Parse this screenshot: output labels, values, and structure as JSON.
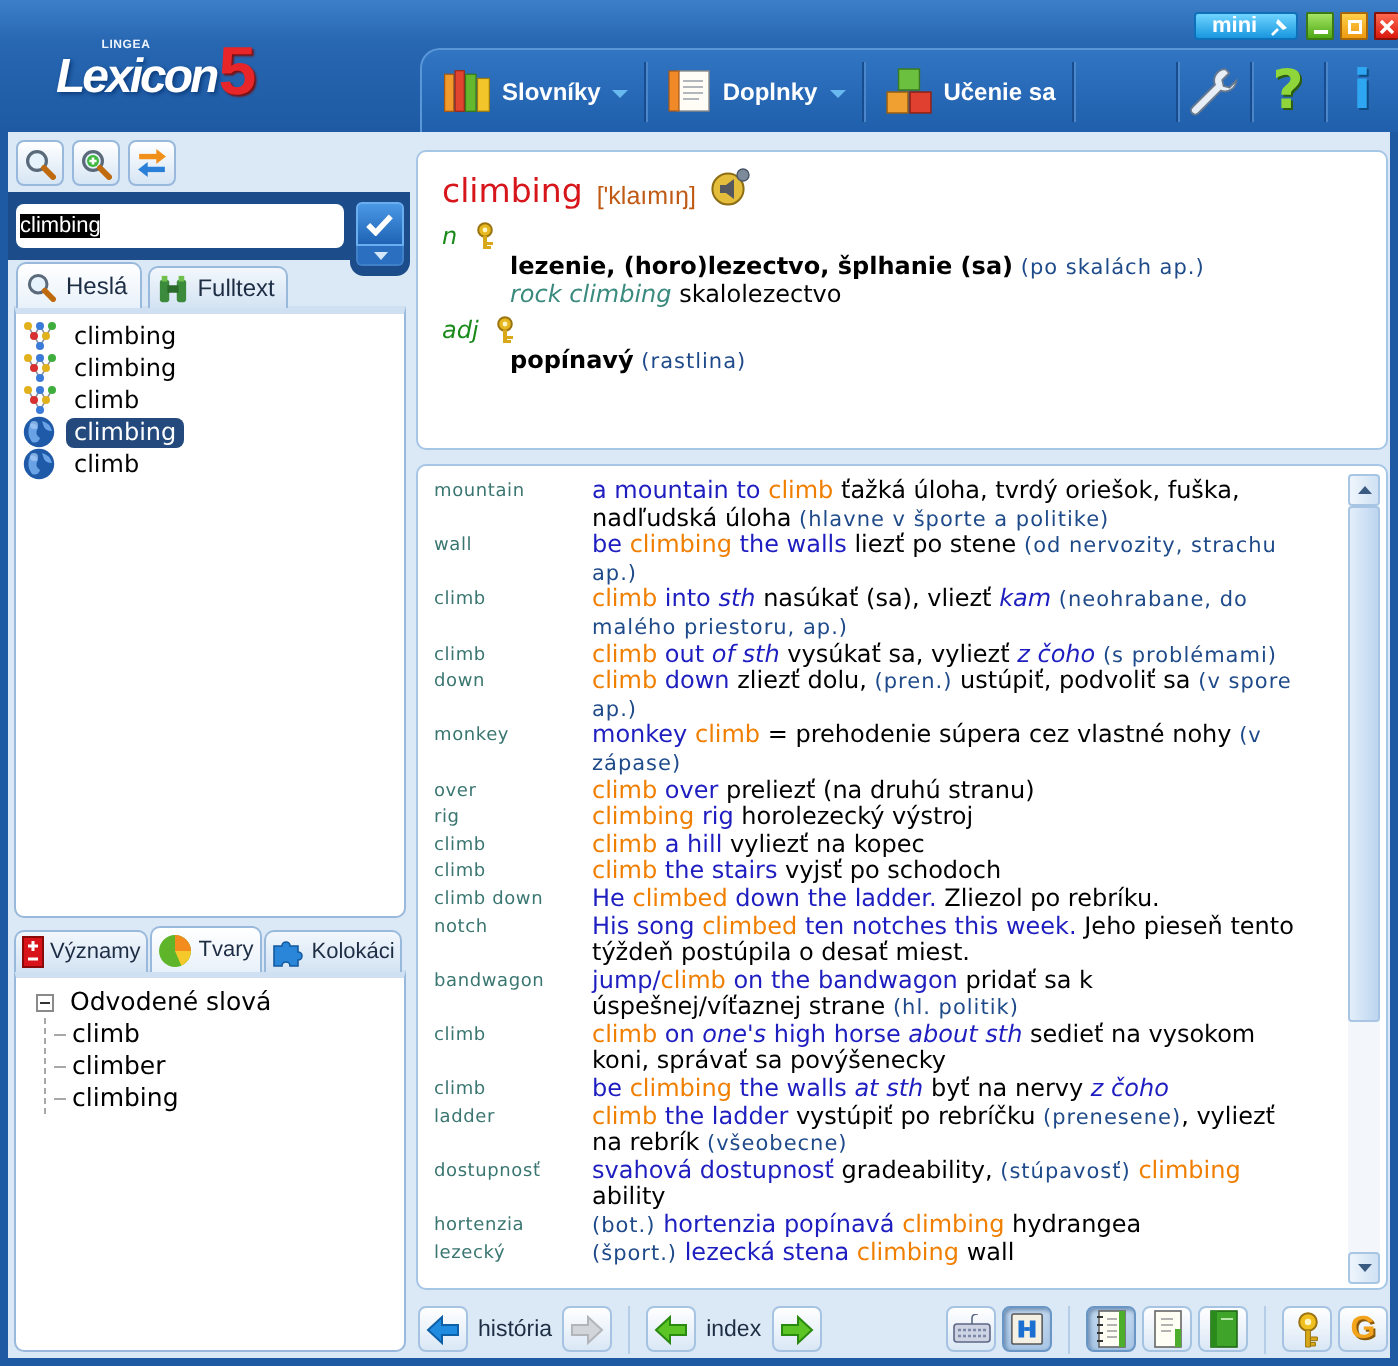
{
  "header": {
    "logo": {
      "brand": "LINGEA",
      "name": "Lexicon",
      "version": "5"
    },
    "mini_label": "mini"
  },
  "menu": {
    "items": [
      {
        "label": "Slovníky",
        "dropdown": true
      },
      {
        "label": "Doplnky",
        "dropdown": true
      },
      {
        "label": "Učenie sa",
        "dropdown": false
      }
    ],
    "help": "?",
    "info": "i"
  },
  "search": {
    "value": "climbing",
    "text_selected": true
  },
  "word_tabs": [
    {
      "label": "Heslá",
      "selected": true
    },
    {
      "label": "Fulltext",
      "selected": false
    }
  ],
  "word_list": [
    {
      "word": "climbing",
      "kind": "phrase",
      "selected": false
    },
    {
      "word": "climbing",
      "kind": "phrase",
      "selected": false
    },
    {
      "word": "climb",
      "kind": "phrase",
      "selected": false
    },
    {
      "word": "climbing",
      "kind": "headword",
      "selected": true
    },
    {
      "word": "climb",
      "kind": "headword",
      "selected": false
    }
  ],
  "info_tabs": [
    {
      "label": "Významy",
      "selected": false
    },
    {
      "label": "Tvary",
      "selected": true
    },
    {
      "label": "Kolokáci",
      "selected": false
    }
  ],
  "forms_tree": [
    {
      "label": "Odvodené slová",
      "expanded": true,
      "children": [
        {
          "label": "climb"
        },
        {
          "label": "climber"
        },
        {
          "label": "climbing"
        }
      ]
    }
  ],
  "entry": {
    "headword": "climbing",
    "pronunciation": "['klaımıŋ]",
    "senses": [
      {
        "pos": "n",
        "lines": [
          {
            "parts": [
              {
                "kind": "bold",
                "text": "lezenie, (horo)lezectvo, šplhanie (sa)"
              },
              {
                "kind": "note",
                "text": " (po skalách ap.)"
              }
            ]
          },
          {
            "parts": [
              {
                "kind": "phrase",
                "text": "rock climbing"
              },
              {
                "kind": "sk",
                "text": " skalolezectvo"
              }
            ]
          }
        ]
      },
      {
        "pos": "adj",
        "lines": [
          {
            "parts": [
              {
                "kind": "bold",
                "text": "popínavý"
              },
              {
                "kind": "note",
                "text": " (rastlina)"
              }
            ]
          }
        ]
      }
    ]
  },
  "examples": [
    {
      "keyword": "mountain",
      "parts": [
        {
          "kind": "en",
          "text": "a mountain to "
        },
        {
          "kind": "hit",
          "text": "climb"
        },
        {
          "kind": "sk",
          "text": " ťažká úloha, tvrdý oriešok, fuška, nadľudská úloha "
        },
        {
          "kind": "note",
          "text": "(hlavne v športe a politike)"
        }
      ]
    },
    {
      "keyword": "wall",
      "parts": [
        {
          "kind": "en",
          "text": "be "
        },
        {
          "kind": "hit",
          "text": "climbing"
        },
        {
          "kind": "en",
          "text": " the walls"
        },
        {
          "kind": "sk",
          "text": " liezť po stene "
        },
        {
          "kind": "note",
          "text": "(od nervozity, strachu ap.)"
        }
      ]
    },
    {
      "keyword": "climb",
      "parts": [
        {
          "kind": "hit",
          "text": "climb"
        },
        {
          "kind": "en",
          "text": " into "
        },
        {
          "kind": "en_it",
          "text": "sth"
        },
        {
          "kind": "sk",
          "text": " nasúkať (sa), vliezť "
        },
        {
          "kind": "ref_it",
          "text": "kam"
        },
        {
          "kind": "note",
          "text": " (neohrabane, do malého priestoru, ap.)"
        }
      ]
    },
    {
      "keyword": "climb",
      "parts": [
        {
          "kind": "hit",
          "text": "climb"
        },
        {
          "kind": "en",
          "text": " out "
        },
        {
          "kind": "en_it",
          "text": "of sth"
        },
        {
          "kind": "sk",
          "text": " vysúkať sa, vyliezť "
        },
        {
          "kind": "ref_it",
          "text": "z čoho"
        },
        {
          "kind": "note",
          "text": " (s problémami)"
        }
      ]
    },
    {
      "keyword": "down",
      "parts": [
        {
          "kind": "hit",
          "text": "climb"
        },
        {
          "kind": "en",
          "text": " down"
        },
        {
          "kind": "sk",
          "text": " zliezť dolu, "
        },
        {
          "kind": "note",
          "text": "(pren.)"
        },
        {
          "kind": "sk",
          "text": " ustúpiť, podvoliť sa "
        },
        {
          "kind": "note",
          "text": "(v spore ap.)"
        }
      ]
    },
    {
      "keyword": "monkey",
      "parts": [
        {
          "kind": "en",
          "text": "monkey "
        },
        {
          "kind": "hit",
          "text": "climb"
        },
        {
          "kind": "sk",
          "text": " = prehodenie súpera cez vlastné nohy "
        },
        {
          "kind": "note",
          "text": "(v zápase)"
        }
      ]
    },
    {
      "keyword": "over",
      "parts": [
        {
          "kind": "hit",
          "text": "climb"
        },
        {
          "kind": "en",
          "text": " over"
        },
        {
          "kind": "sk",
          "text": " preliezť (na druhú stranu)"
        }
      ]
    },
    {
      "keyword": "rig",
      "parts": [
        {
          "kind": "hit",
          "text": "climbing"
        },
        {
          "kind": "en",
          "text": " rig"
        },
        {
          "kind": "sk",
          "text": " horolezecký výstroj"
        }
      ]
    },
    {
      "keyword": "climb",
      "parts": [
        {
          "kind": "hit",
          "text": "climb"
        },
        {
          "kind": "en",
          "text": " a hill"
        },
        {
          "kind": "sk",
          "text": " vyliezť na kopec"
        }
      ]
    },
    {
      "keyword": "climb",
      "parts": [
        {
          "kind": "hit",
          "text": "climb"
        },
        {
          "kind": "en",
          "text": " the stairs"
        },
        {
          "kind": "sk",
          "text": " vyjsť po schodoch"
        }
      ]
    },
    {
      "keyword": "climb down",
      "parts": [
        {
          "kind": "en",
          "text": "He "
        },
        {
          "kind": "hit",
          "text": "climbed"
        },
        {
          "kind": "en",
          "text": " down the ladder."
        },
        {
          "kind": "sk",
          "text": " Zliezol po rebríku."
        }
      ]
    },
    {
      "keyword": "notch",
      "parts": [
        {
          "kind": "en",
          "text": "His song "
        },
        {
          "kind": "hit",
          "text": "climbed"
        },
        {
          "kind": "en",
          "text": " ten notches this week."
        },
        {
          "kind": "sk",
          "text": " Jeho pieseň tento týždeň postúpila o desať miest."
        }
      ]
    },
    {
      "keyword": "bandwagon",
      "parts": [
        {
          "kind": "en",
          "text": "jump/"
        },
        {
          "kind": "hit",
          "text": "climb"
        },
        {
          "kind": "en",
          "text": " on the bandwagon"
        },
        {
          "kind": "sk",
          "text": " pridať sa k úspešnej/víťaznej strane "
        },
        {
          "kind": "note",
          "text": "(hl. politik)"
        }
      ]
    },
    {
      "keyword": "climb",
      "parts": [
        {
          "kind": "hit",
          "text": "climb"
        },
        {
          "kind": "en",
          "text": " on "
        },
        {
          "kind": "en_it",
          "text": "one's"
        },
        {
          "kind": "en",
          "text": " high horse "
        },
        {
          "kind": "en_it",
          "text": "about sth"
        },
        {
          "kind": "sk",
          "text": " sedieť na vysokom koni, správať sa povýšenecky"
        }
      ]
    },
    {
      "keyword": "climb",
      "parts": [
        {
          "kind": "en",
          "text": "be "
        },
        {
          "kind": "hit",
          "text": "climbing"
        },
        {
          "kind": "en",
          "text": " the walls "
        },
        {
          "kind": "en_it",
          "text": "at sth"
        },
        {
          "kind": "sk",
          "text": " byť na nervy "
        },
        {
          "kind": "ref_it",
          "text": "z čoho"
        }
      ]
    },
    {
      "keyword": "ladder",
      "parts": [
        {
          "kind": "hit",
          "text": "climb"
        },
        {
          "kind": "en",
          "text": " the ladder"
        },
        {
          "kind": "sk",
          "text": " vystúpiť po rebríčku "
        },
        {
          "kind": "note",
          "text": "(prenesene)"
        },
        {
          "kind": "sk",
          "text": ", vyliezť na rebrík "
        },
        {
          "kind": "note",
          "text": "(všeobecne)"
        }
      ]
    },
    {
      "keyword": "dostupnosť",
      "parts": [
        {
          "kind": "en",
          "text": "svahová dostupnosť"
        },
        {
          "kind": "sk",
          "text": " gradeability, "
        },
        {
          "kind": "note",
          "text": "(stúpavosť)"
        },
        {
          "kind": "hit",
          "text": " climbing"
        },
        {
          "kind": "sk",
          "text": " ability"
        }
      ]
    },
    {
      "keyword": "hortenzia",
      "parts": [
        {
          "kind": "note",
          "text": "(bot.)"
        },
        {
          "kind": "en",
          "text": " hortenzia popínavá"
        },
        {
          "kind": "hit",
          "text": " climbing"
        },
        {
          "kind": "sk",
          "text": " hydrangea"
        }
      ]
    },
    {
      "keyword": "lezecký",
      "parts": [
        {
          "kind": "note",
          "text": "(šport.)"
        },
        {
          "kind": "en",
          "text": " lezecká stena"
        },
        {
          "kind": "hit",
          "text": " climbing"
        },
        {
          "kind": "sk",
          "text": " wall"
        }
      ]
    }
  ],
  "navigation": {
    "history": {
      "label": "história",
      "back_disabled": false,
      "forward_disabled": true
    },
    "index": {
      "label": "index",
      "back_disabled": false,
      "forward_disabled": false
    }
  },
  "toolbar": {
    "tools": [
      {
        "kind": "keyboard",
        "pressed": false
      },
      {
        "kind": "split",
        "pressed": true
      }
    ],
    "views": [
      {
        "kind": "notebook",
        "selected": true
      },
      {
        "kind": "page",
        "selected": false
      },
      {
        "kind": "book",
        "selected": false
      }
    ],
    "letter": "G"
  }
}
